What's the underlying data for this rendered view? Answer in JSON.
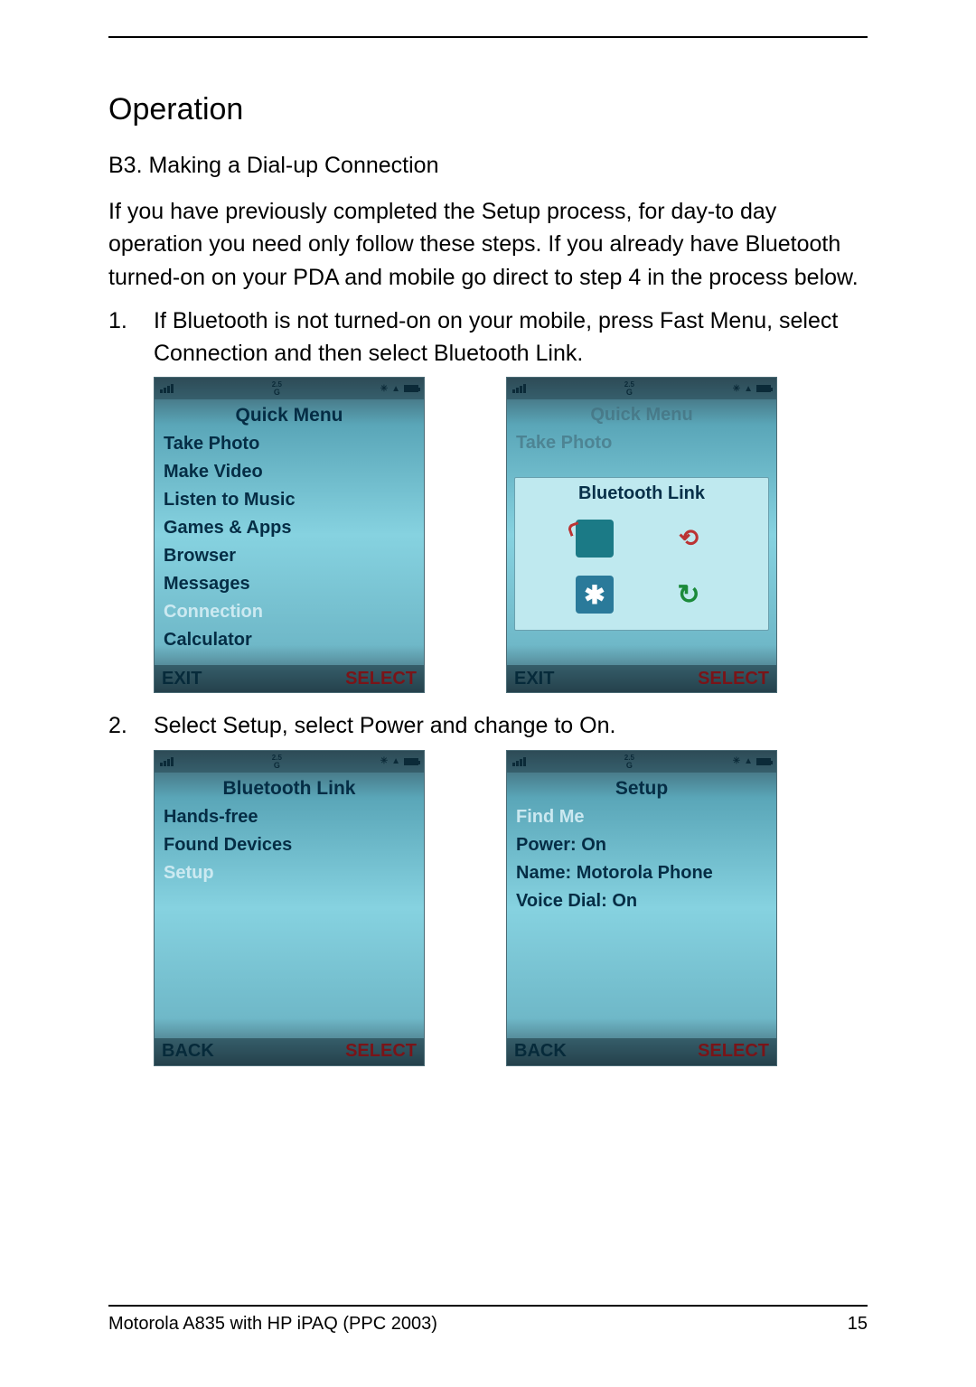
{
  "heading": "Operation",
  "subheading": "B3. Making a Dial-up Connection",
  "intro": "If you have previously completed the Setup process, for day-to day operation you need only follow these steps. If you already have Bluetooth turned-on on your PDA and mobile go direct to step 4 in the process below.",
  "steps": {
    "s1_num": "1.",
    "s1_text": "If Bluetooth is not turned-on on your mobile, press Fast Menu, select Connection and then select Bluetooth Link.",
    "s2_num": "2.",
    "s2_text": "Select Setup, select Power and change to On."
  },
  "statusbar": {
    "g25_top": "2.5",
    "g25_bot": "G"
  },
  "softkeys": {
    "exit": "EXIT",
    "select": "SELECT",
    "back": "BACK"
  },
  "screens": {
    "quickmenu": {
      "title": "Quick Menu",
      "items": [
        "Take Photo",
        "Make Video",
        "Listen to Music",
        "Games & Apps",
        "Browser",
        "Messages",
        "Connection",
        "Calculator"
      ],
      "selected": "Connection"
    },
    "btlink_popup": {
      "dim_title": "Quick Menu",
      "dim_item": "Take Photo",
      "card_title": "Bluetooth Link"
    },
    "btlink_list": {
      "title": "Bluetooth Link",
      "items": [
        "Hands-free",
        "Found Devices",
        "Setup"
      ],
      "selected": "Setup"
    },
    "setup": {
      "title": "Setup",
      "items": [
        "Find Me",
        "Power: On",
        "Name: Motorola Phone",
        "Voice Dial: On"
      ],
      "selected": "Find Me"
    }
  },
  "footer": {
    "left": "Motorola A835 with HP iPAQ (PPC 2003)",
    "right": "15"
  }
}
